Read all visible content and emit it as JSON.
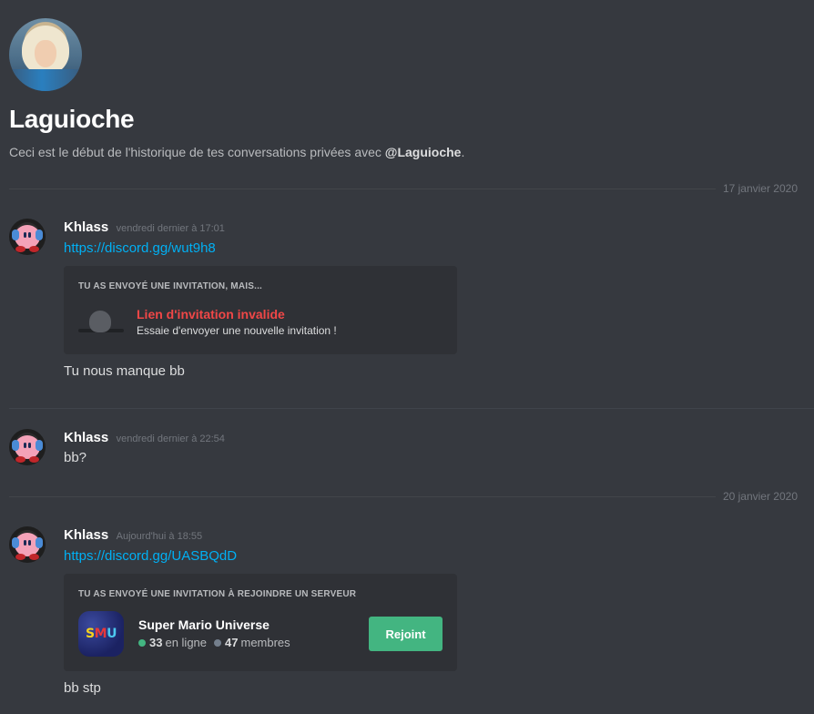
{
  "header": {
    "title": "Laguioche",
    "subtitle_prefix": "Ceci est le début de l'historique de tes conversations privées avec ",
    "mention": "@Laguioche",
    "subtitle_suffix": "."
  },
  "dates": {
    "first": "17 janvier 2020",
    "second": "20 janvier 2020"
  },
  "messages": [
    {
      "username": "Khlass",
      "timestamp": "vendredi dernier à 17:01",
      "link": "https://discord.gg/wut9h8",
      "invite": {
        "header": "TU AS ENVOYÉ UNE INVITATION, MAIS...",
        "title": "Lien d'invitation invalide",
        "subtitle": "Essaie d'envoyer une nouvelle invitation !"
      },
      "text": "Tu nous manque bb"
    },
    {
      "username": "Khlass",
      "timestamp": "vendredi dernier à 22:54",
      "text": "bb?"
    },
    {
      "username": "Khlass",
      "timestamp": "Aujourd'hui à 18:55",
      "link": "https://discord.gg/UASBQdD",
      "invite": {
        "header": "TU AS ENVOYÉ UNE INVITATION À REJOINDRE UN SERVEUR",
        "server_name": "Super Mario Universe",
        "server_icon_letters": [
          "S",
          "M",
          "U"
        ],
        "online_count": "33",
        "online_label": "en ligne",
        "members_count": "47",
        "members_label": "membres",
        "button": "Rejoint"
      },
      "text": "bb stp"
    }
  ],
  "colors": {
    "background": "#36393f",
    "card": "#2f3136",
    "link": "#00b0f4",
    "error": "#f04747",
    "online": "#43b581",
    "button": "#43b581"
  }
}
